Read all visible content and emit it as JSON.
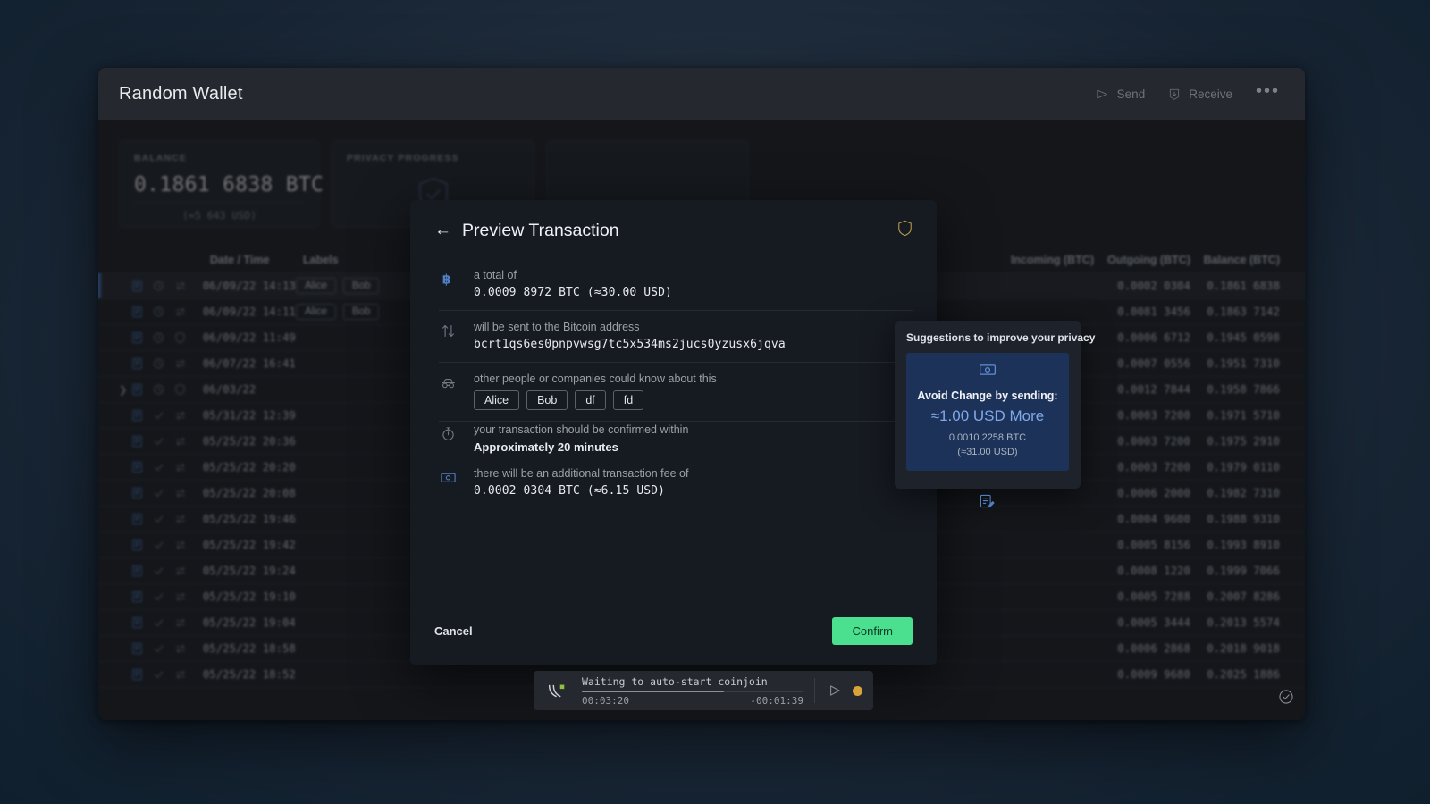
{
  "window": {
    "title": "Random Wallet",
    "actions": [
      {
        "name": "send",
        "label": "Send",
        "icon": "send-icon"
      },
      {
        "name": "receive",
        "label": "Receive",
        "icon": "receive-icon"
      }
    ],
    "more_label": "•••"
  },
  "cards": {
    "balance": {
      "label": "BALANCE",
      "amount": "0.1861 6838 BTC",
      "usd": "(≈5 643 USD)"
    },
    "privacy": {
      "label": "PRIVACY PROGRESS"
    },
    "third": {
      "label": ""
    }
  },
  "table": {
    "headers": {
      "date": "Date / Time",
      "labels": "Labels",
      "incoming": "Incoming (BTC)",
      "outgoing": "Outgoing (BTC)",
      "balance": "Balance (BTC)"
    },
    "rows": [
      {
        "selected": true,
        "expandable": false,
        "icons": [
          "doc",
          "clock",
          "arrows"
        ],
        "date": "06/09/22 14:13",
        "labels": [
          "Alice",
          "Bob"
        ],
        "incoming": "",
        "outgoing": "0.0002 0304",
        "balance": "0.1861 6838"
      },
      {
        "selected": false,
        "expandable": false,
        "icons": [
          "doc",
          "clock",
          "arrows"
        ],
        "date": "06/09/22 14:11",
        "labels": [
          "Alice",
          "Bob"
        ],
        "incoming": "",
        "outgoing": "0.0081 3456",
        "balance": "0.1863 7142"
      },
      {
        "selected": false,
        "expandable": false,
        "icons": [
          "doc",
          "clock",
          "shield"
        ],
        "date": "06/09/22 11:49",
        "labels": [],
        "incoming": "",
        "outgoing": "0.0006 6712",
        "balance": "0.1945 0598"
      },
      {
        "selected": false,
        "expandable": false,
        "icons": [
          "doc",
          "clock",
          "arrows"
        ],
        "date": "06/07/22 16:41",
        "labels": [],
        "incoming": "",
        "outgoing": "0.0007 0556",
        "balance": "0.1951 7310"
      },
      {
        "selected": false,
        "expandable": true,
        "icons": [
          "doc",
          "clock",
          "shield"
        ],
        "date": "06/03/22",
        "labels": [],
        "incoming": "",
        "outgoing": "0.0012 7844",
        "balance": "0.1958 7866"
      },
      {
        "selected": false,
        "expandable": false,
        "icons": [
          "doc",
          "check",
          "arrows"
        ],
        "date": "05/31/22 12:39",
        "labels": [],
        "incoming": "",
        "outgoing": "0.0003 7200",
        "balance": "0.1971 5710"
      },
      {
        "selected": false,
        "expandable": false,
        "icons": [
          "doc",
          "check",
          "arrows"
        ],
        "date": "05/25/22 20:36",
        "labels": [],
        "incoming": "",
        "outgoing": "0.0003 7200",
        "balance": "0.1975 2910"
      },
      {
        "selected": false,
        "expandable": false,
        "icons": [
          "doc",
          "check",
          "arrows"
        ],
        "date": "05/25/22 20:20",
        "labels": [],
        "incoming": "",
        "outgoing": "0.0003 7200",
        "balance": "0.1979 0110"
      },
      {
        "selected": false,
        "expandable": false,
        "icons": [
          "doc",
          "check",
          "arrows"
        ],
        "date": "05/25/22 20:08",
        "labels": [],
        "incoming": "",
        "outgoing": "0.0006 2000",
        "balance": "0.1982 7310"
      },
      {
        "selected": false,
        "expandable": false,
        "icons": [
          "doc",
          "check",
          "arrows"
        ],
        "date": "05/25/22 19:46",
        "labels": [],
        "incoming": "",
        "outgoing": "0.0004 9600",
        "balance": "0.1988 9310"
      },
      {
        "selected": false,
        "expandable": false,
        "icons": [
          "doc",
          "check",
          "arrows"
        ],
        "date": "05/25/22 19:42",
        "labels": [],
        "incoming": "",
        "outgoing": "0.0005 8156",
        "balance": "0.1993 8910"
      },
      {
        "selected": false,
        "expandable": false,
        "icons": [
          "doc",
          "check",
          "arrows"
        ],
        "date": "05/25/22 19:24",
        "labels": [],
        "incoming": "",
        "outgoing": "0.0008 1220",
        "balance": "0.1999 7066"
      },
      {
        "selected": false,
        "expandable": false,
        "icons": [
          "doc",
          "check",
          "arrows"
        ],
        "date": "05/25/22 19:10",
        "labels": [],
        "incoming": "",
        "outgoing": "0.0005 7288",
        "balance": "0.2007 8286"
      },
      {
        "selected": false,
        "expandable": false,
        "icons": [
          "doc",
          "check",
          "arrows"
        ],
        "date": "05/25/22 19:04",
        "labels": [],
        "incoming": "",
        "outgoing": "0.0005 3444",
        "balance": "0.2013 5574"
      },
      {
        "selected": false,
        "expandable": false,
        "icons": [
          "doc",
          "check",
          "arrows"
        ],
        "date": "05/25/22 18:58",
        "labels": [],
        "incoming": "",
        "outgoing": "0.0006 2868",
        "balance": "0.2018 9018"
      },
      {
        "selected": false,
        "expandable": false,
        "icons": [
          "doc",
          "check",
          "arrows"
        ],
        "date": "05/25/22 18:52",
        "labels": [],
        "incoming": "",
        "outgoing": "0.0009 9680",
        "balance": "0.2025 1886"
      }
    ]
  },
  "dialog": {
    "title": "Preview Transaction",
    "back_icon": "back-arrow-icon",
    "shield_icon": "shield-icon",
    "rows": {
      "total": {
        "icon": "bitcoin-icon",
        "label": "a total of",
        "value": "0.0009 8972 BTC (≈30.00 USD)"
      },
      "address": {
        "icon": "transfer-icon",
        "label": "will be sent to the Bitcoin address",
        "value": "bcrt1qs6es0pnpvwsg7tc5x534ms2jucs0yzusx6jqva"
      },
      "observers": {
        "icon": "incognito-icon",
        "label": "other people or companies could know about this",
        "pills": [
          "Alice",
          "Bob",
          "df",
          "fd"
        ]
      },
      "confirm_time": {
        "icon": "stopwatch-icon",
        "label": "your transaction should be confirmed within",
        "value": "Approximately 20 minutes"
      },
      "fee": {
        "icon": "banknote-icon",
        "label": "there will be an additional transaction fee of",
        "value": "0.0002 0304 BTC (≈6.15 USD)"
      }
    },
    "cancel_label": "Cancel",
    "confirm_label": "Confirm"
  },
  "suggestions": {
    "title": "Suggestions to improve your privacy",
    "card": {
      "icon": "banknote-icon",
      "heading": "Avoid Change by sending:",
      "amount": "≈1.00 USD  More",
      "btc": "0.0010 2258 BTC",
      "usd": "(≈31.00 USD)"
    },
    "edit_icon": "edit-labels-icon"
  },
  "coinjoin": {
    "icon": "coinjoin-icon",
    "status": "Waiting to auto-start coinjoin",
    "elapsed": "00:03:20",
    "remaining": "-00:01:39",
    "progress_percent": 64,
    "play_icon": "play-icon",
    "indicator_color": "#d8a43a"
  },
  "colors": {
    "accent_green": "#4ae08f",
    "accent_blue": "#3f6fb5",
    "suggest_blue": "#1d3258",
    "window_bg": "#1b1e23"
  }
}
